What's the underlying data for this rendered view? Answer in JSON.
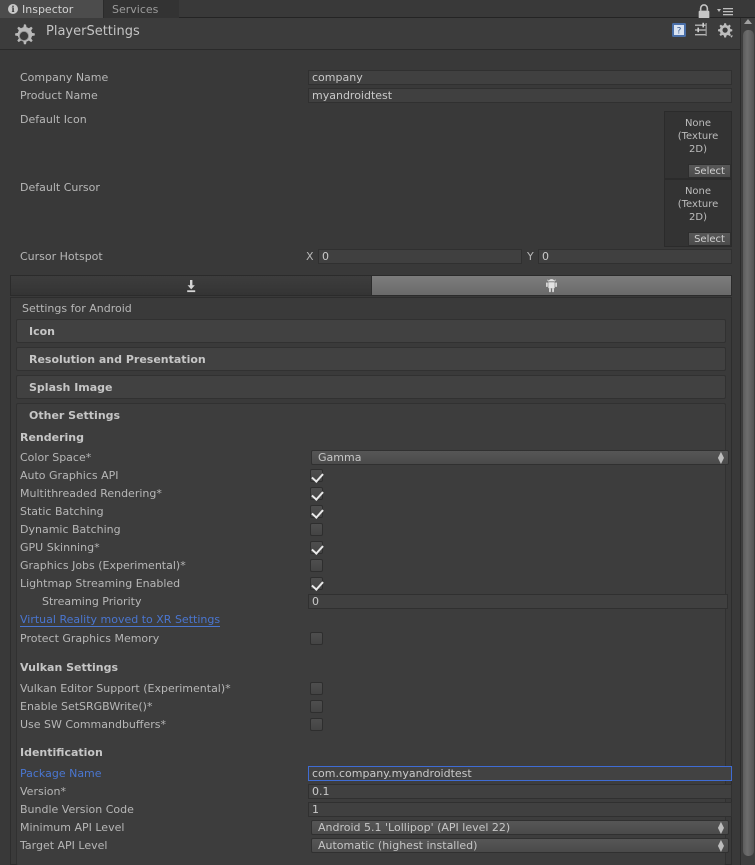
{
  "window": {
    "tabs": [
      {
        "label": "Inspector",
        "icon": "info-icon",
        "active": true
      },
      {
        "label": "Services",
        "icon": "",
        "active": false
      }
    ],
    "lock_icon": "lock-icon",
    "menu_icon": "hamburger-menu-icon",
    "header": {
      "title": "PlayerSettings",
      "gear_icon": "gear-icon",
      "icons": [
        "help-book-icon",
        "preset-sliders-icon",
        "settings-gear-icon"
      ]
    }
  },
  "general": {
    "company_name": {
      "label": "Company Name",
      "value": "company"
    },
    "product_name": {
      "label": "Product Name",
      "value": "myandroidtest"
    },
    "default_icon": {
      "label": "Default Icon",
      "value": "None\n(Texture 2D)",
      "select_label": "Select"
    },
    "default_cursor": {
      "label": "Default Cursor",
      "value": "None\n(Texture 2D)",
      "select_label": "Select"
    },
    "cursor_hotspot": {
      "label": "Cursor Hotspot",
      "x_label": "X",
      "x_value": "0",
      "y_label": "Y",
      "y_value": "0"
    }
  },
  "platform_tabs": [
    {
      "icon": "standalone-download-icon",
      "selected": false
    },
    {
      "icon": "android-robot-icon",
      "selected": true
    }
  ],
  "settings_panel": {
    "title": "Settings for Android",
    "foldouts": [
      {
        "label": "Icon",
        "open": false
      },
      {
        "label": "Resolution and Presentation",
        "open": false
      },
      {
        "label": "Splash Image",
        "open": false
      },
      {
        "label": "Other Settings",
        "open": true
      }
    ]
  },
  "other_settings": {
    "rendering": {
      "heading": "Rendering",
      "rows": [
        {
          "label": "Color Space*",
          "type": "popup",
          "value": "Gamma"
        },
        {
          "label": "Auto Graphics API",
          "type": "checkbox",
          "value": true
        },
        {
          "label": "Multithreaded Rendering*",
          "type": "checkbox",
          "value": true
        },
        {
          "label": "Static Batching",
          "type": "checkbox",
          "value": true
        },
        {
          "label": "Dynamic Batching",
          "type": "checkbox",
          "value": false
        },
        {
          "label": "GPU Skinning*",
          "type": "checkbox",
          "value": true
        },
        {
          "label": "Graphics Jobs (Experimental)*",
          "type": "checkbox",
          "value": false
        },
        {
          "label": "Lightmap Streaming Enabled",
          "type": "checkbox",
          "value": true
        },
        {
          "label": "Streaming Priority",
          "type": "text",
          "value": "0",
          "indent": true
        },
        {
          "label": "Virtual Reality moved to XR Settings",
          "type": "link"
        },
        {
          "label": "Protect Graphics Memory",
          "type": "checkbox",
          "value": false
        }
      ]
    },
    "vulkan": {
      "heading": "Vulkan Settings",
      "rows": [
        {
          "label": "Vulkan Editor Support (Experimental)*",
          "type": "checkbox",
          "value": false
        },
        {
          "label": "Enable SetSRGBWrite()*",
          "type": "checkbox",
          "value": false
        },
        {
          "label": "Use SW Commandbuffers*",
          "type": "checkbox",
          "value": false
        }
      ]
    },
    "identification": {
      "heading": "Identification",
      "rows": [
        {
          "label": "Package Name",
          "type": "text",
          "value": "com.company.myandroidtest",
          "label_blue": true,
          "focused": true
        },
        {
          "label": "Version*",
          "type": "text",
          "value": "0.1"
        },
        {
          "label": "Bundle Version Code",
          "type": "text",
          "value": "1"
        },
        {
          "label": "Minimum API Level",
          "type": "popup",
          "value": "Android 5.1 'Lollipop' (API level 22)"
        },
        {
          "label": "Target API Level",
          "type": "popup",
          "value": "Automatic (highest installed)"
        }
      ]
    }
  },
  "colors": {
    "background": "#393939",
    "panel": "#3a3a3a",
    "field": "#404040",
    "text": "#b7b7b7",
    "link": "#4a76d0",
    "focus_border": "#3f6cd4"
  }
}
